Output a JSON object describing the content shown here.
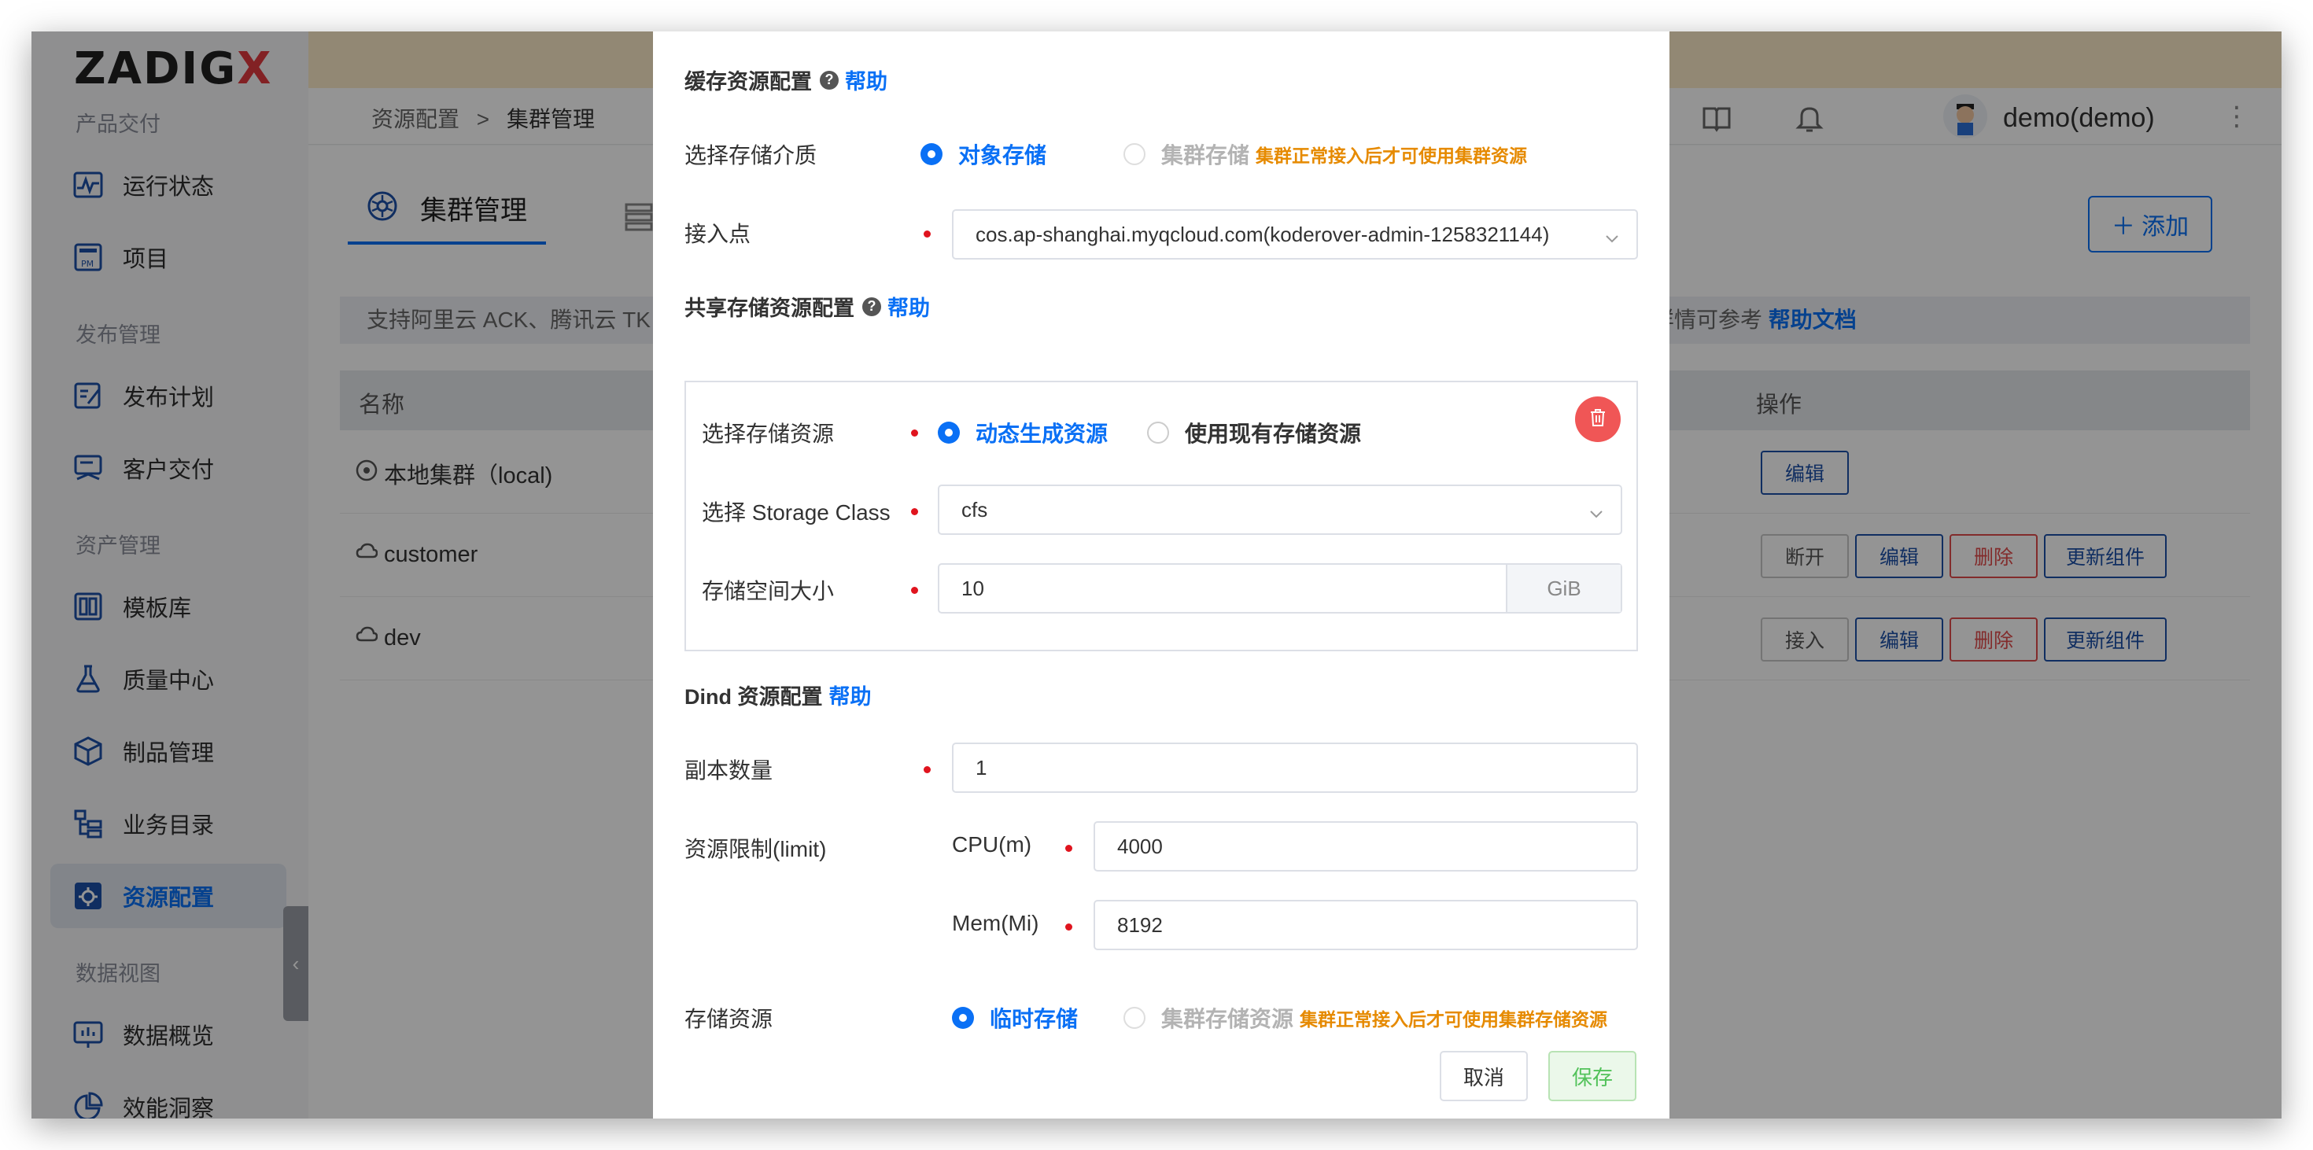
{
  "logo": {
    "text_a": "ZADIG",
    "text_b": "X"
  },
  "sidebar": {
    "sections": [
      "产品交付",
      "发布管理",
      "资产管理",
      "数据视图"
    ],
    "items": [
      {
        "label": "运行状态",
        "icon": "pulse-icon"
      },
      {
        "label": "项目",
        "icon": "project-icon"
      },
      {
        "label": "发布计划",
        "icon": "plan-icon"
      },
      {
        "label": "客户交付",
        "icon": "delivery-icon"
      },
      {
        "label": "模板库",
        "icon": "template-icon"
      },
      {
        "label": "质量中心",
        "icon": "flask-icon"
      },
      {
        "label": "制品管理",
        "icon": "package-icon"
      },
      {
        "label": "业务目录",
        "icon": "catalog-icon"
      },
      {
        "label": "资源配置",
        "icon": "gear-icon",
        "active": true
      },
      {
        "label": "数据概览",
        "icon": "chart-icon"
      },
      {
        "label": "效能洞察",
        "icon": "pie-icon"
      }
    ],
    "collapse_glyph": "‹"
  },
  "topbar": {
    "breadcrumb": [
      "资源配置",
      ">",
      "集群管理"
    ],
    "user": "demo(demo)",
    "more": "⋮"
  },
  "tabs": {
    "active": "集群管理"
  },
  "add_button": "＋ 添加",
  "tip": {
    "left": "支持阿里云 ACK、腾讯云 TK",
    "right": "使用，详情可参考 ",
    "link": "帮助文档"
  },
  "table": {
    "headers": [
      "名称",
      "操作"
    ],
    "rows": [
      {
        "name": "本地集群（local)",
        "icon": "k8s-icon",
        "actions": [
          "编辑"
        ]
      },
      {
        "name": "customer",
        "icon": "cloud-icon",
        "actions": [
          "断开",
          "编辑",
          "删除",
          "更新组件"
        ]
      },
      {
        "name": "dev",
        "icon": "cloud-icon",
        "actions": [
          "接入",
          "编辑",
          "删除",
          "更新组件"
        ]
      }
    ]
  },
  "dialog": {
    "cache": {
      "title": "缓存资源配置",
      "help": "帮助",
      "medium_label": "选择存储介质",
      "opt_object": "对象存储",
      "opt_cluster": "集群存储",
      "cluster_warn": "集群正常接入后才可使用集群资源",
      "endpoint_label": "接入点",
      "endpoint_value": "cos.ap-shanghai.myqcloud.com(koderover-admin-1258321144)"
    },
    "share": {
      "title": "共享存储资源配置",
      "help": "帮助",
      "resource_label": "选择存储资源",
      "opt_dynamic": "动态生成资源",
      "opt_existing": "使用现有存储资源",
      "sc_label": "选择 Storage Class",
      "sc_value": "cfs",
      "size_label": "存储空间大小",
      "size_value": "10",
      "size_unit": "GiB"
    },
    "dind": {
      "title": "Dind 资源配置",
      "help": "帮助",
      "replica_label": "副本数量",
      "replica_value": "1",
      "limit_label": "资源限制(limit)",
      "cpu_label": "CPU(m)",
      "cpu_value": "4000",
      "mem_label": "Mem(Mi)",
      "mem_value": "8192",
      "storage_label": "存储资源",
      "opt_temp": "临时存储",
      "opt_cluster": "集群存储资源",
      "cluster_warn": "集群正常接入后才可使用集群存储资源"
    },
    "cancel": "取消",
    "save": "保存"
  },
  "colors": {
    "primary": "#0a70f5",
    "danger": "#e0141e",
    "warn": "#e68a00",
    "success": "#52c25a"
  }
}
